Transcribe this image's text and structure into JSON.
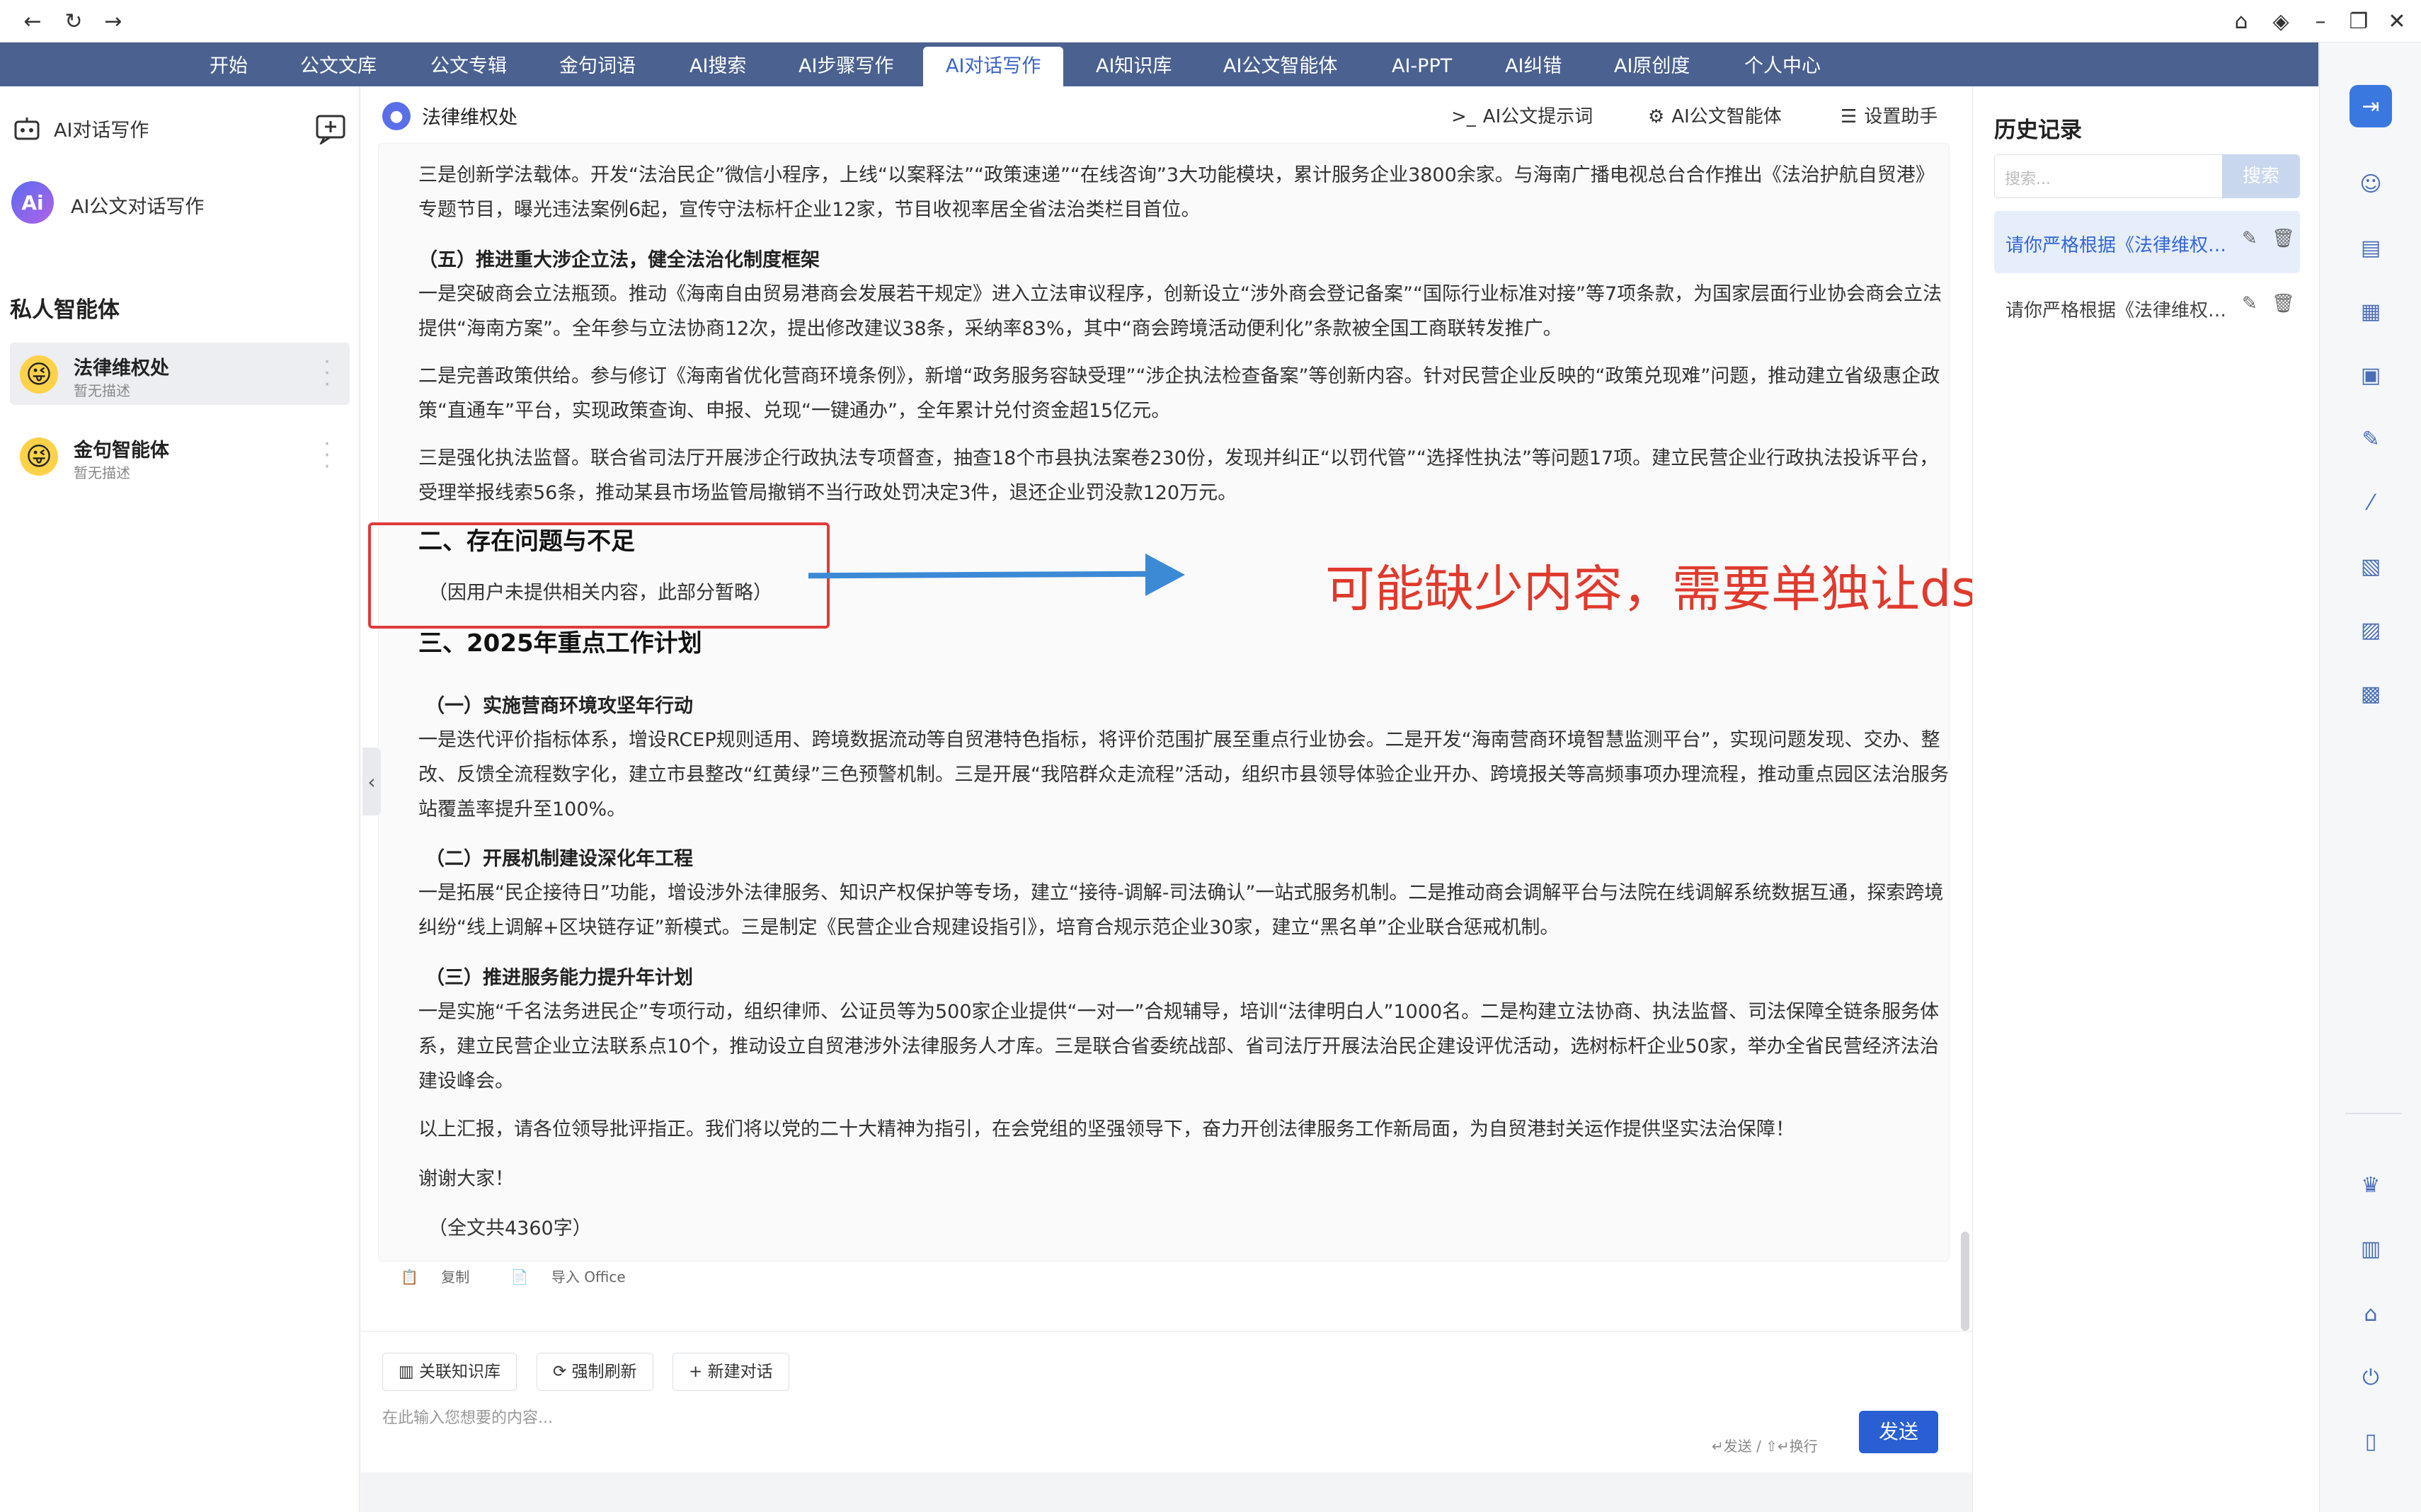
{
  "browser": {
    "back_icon": "arrow-left-icon",
    "reload_icon": "reload-icon",
    "forward_icon": "arrow-right-icon"
  },
  "nav": {
    "items": [
      "开始",
      "公文文库",
      "公文专辑",
      "金句词语",
      "AI搜索",
      "AI步骤写作",
      "AI对话写作",
      "AI知识库",
      "AI公文智能体",
      "AI-PPT",
      "AI纠错",
      "AI原创度",
      "个人中心"
    ],
    "active": "AI对话写作"
  },
  "sidebar": {
    "title": "AI对话写作",
    "ai_label": "AI公文对话写作",
    "logo_text": "Ai",
    "section": "私人智能体",
    "agents": [
      {
        "name": "法律维权处",
        "desc": "暂无描述"
      },
      {
        "name": "金句智能体",
        "desc": "暂无描述"
      }
    ]
  },
  "main": {
    "title": "法律维权处",
    "btn_prompt": "AI公文提示词",
    "btn_agent": "AI公文智能体",
    "btn_settings": "设置助手"
  },
  "doc": {
    "p1": "三是创新学法载体。开发“法治民企”微信小程序，上线“以案释法”“政策速递”“在线咨询”3大功能模块，累计服务企业3800余家。与海南广播电视总台合作推出《法治护航自贸港》专题节目，曝光违法案例6起，宣传守法标杆企业12家，节目收视率居全省法治类栏目首位。",
    "h_5": "（五）推进重大涉企立法，健全法治化制度框架",
    "p2": "一是突破商会立法瓶颈。推动《海南自由贸易港商会发展若干规定》进入立法审议程序，创新设立“涉外商会登记备案”“国际行业标准对接”等7项条款，为国家层面行业协会商会立法提供“海南方案”。全年参与立法协商12次，提出修改建议38条，采纳率83%，其中“商会跨境活动便利化”条款被全国工商联转发推广。",
    "p3": "二是完善政策供给。参与修订《海南省优化营商环境条例》，新增“政务服务容缺受理”“涉企执法检查备案”等创新内容。针对民营企业反映的“政策兑现难”问题，推动建立省级惠企政策“直通车”平台，实现政策查询、申报、兑现“一键通办”，全年累计兑付资金超15亿元。",
    "p4": "三是强化执法监督。联合省司法厅开展涉企行政执法专项督查，抽查18个市县执法案卷230份，发现并纠正“以罚代管”“选择性执法”等问题17项。建立民营企业行政执法投诉平台，受理举报线索56条，推动某县市场监管局撤销不当行政处罚决定3件，退还企业罚没款120万元。",
    "h2_problems": "二、存在问题与不足",
    "p_problems": "（因用户未提供相关内容，此部分暂略）",
    "h2_plan": "三、2025年重点工作计划",
    "h_1": "（一）实施营商环境攻坚年行动",
    "p5": "一是迭代评价指标体系，增设RCEP规则适用、跨境数据流动等自贸港特色指标，将评价范围扩展至重点行业协会。二是开发“海南营商环境智慧监测平台”，实现问题发现、交办、整改、反馈全流程数字化，建立市县整改“红黄绿”三色预警机制。三是开展“我陪群众走流程”活动，组织市县领导体验企业开办、跨境报关等高频事项办理流程，推动重点园区法治服务站覆盖率提升至100%。",
    "h_2": "（二）开展机制建设深化年工程",
    "p6": "一是拓展“民企接待日”功能，增设涉外法律服务、知识产权保护等专场，建立“接待-调解-司法确认”一站式服务机制。二是推动商会调解平台与法院在线调解系统数据互通，探索跨境纠纷“线上调解+区块链存证”新模式。三是制定《民营企业合规建设指引》，培育合规示范企业30家，建立“黑名单”企业联合惩戒机制。",
    "h_3": "（三）推进服务能力提升年计划",
    "p7": "一是实施“千名法务进民企”专项行动，组织律师、公证员等为500家企业提供“一对一”合规辅导，培训“法律明白人”1000名。二是构建立法协商、执法监督、司法保障全链条服务体系，建立民营企业立法联系点10个，推动设立自贸港涉外法律服务人才库。三是联合省委统战部、省司法厅开展法治民企建设评优活动，选树标杆企业50家，举办全省民营经济法治建设峰会。",
    "p8": "以上汇报，请各位领导批评指正。我们将以党的二十大精神为指引，在会党组的坚强领导下，奋力开创法律服务工作新局面，为自贸港封关运作提供坚实法治保障！",
    "p9": "谢谢大家！",
    "p10": "（全文共4360字）",
    "copy": "复制",
    "export": "导入 Office"
  },
  "annotation": "可能缺少内容，需要单独让ds再写这一部分",
  "input": {
    "btn_kb": "关联知识库",
    "btn_refresh": "强制刷新",
    "btn_new": "新建对话",
    "placeholder": "在此输入您想要的内容...",
    "hint": "↵发送 / ⇧↵换行",
    "send": "发送"
  },
  "history": {
    "title": "历史记录",
    "search_placeholder": "搜索...",
    "search_btn": "搜索",
    "items": [
      "请你严格根据《法律维权处》…",
      "请你严格根据《法律维权处》…"
    ]
  },
  "colors": {
    "nav_bg": "#4b6190",
    "accent": "#2a5fd4",
    "annotation_red": "#e03a2d",
    "arrow_blue": "#3c89d6"
  }
}
